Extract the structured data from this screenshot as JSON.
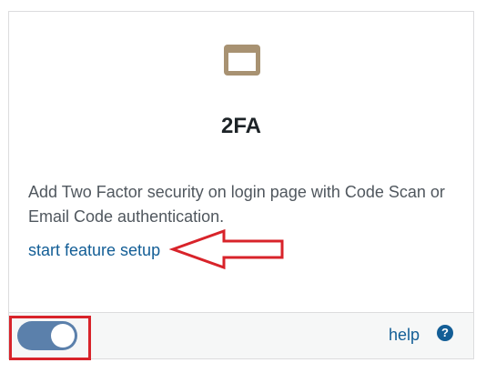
{
  "feature": {
    "icon": "window-icon",
    "title": "2FA",
    "description": "Add Two Factor security on login page with Code Scan or Email Code authentication.",
    "setup_link": "start feature setup"
  },
  "footer": {
    "toggle_state": "on",
    "help_label": "help",
    "help_icon_glyph": "?"
  },
  "colors": {
    "icon": "#a89272",
    "toggle_on": "#5b80ab",
    "link": "#135e96",
    "annotation": "#d8232a"
  }
}
